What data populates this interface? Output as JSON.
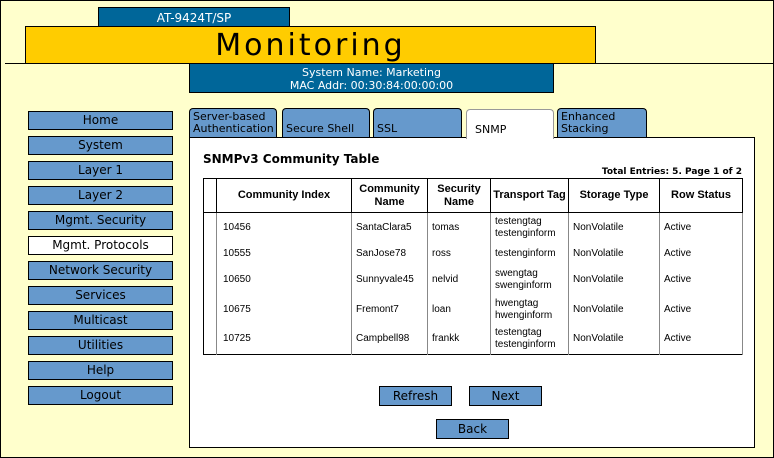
{
  "header": {
    "model": "AT-9424T/SP",
    "title": "Monitoring",
    "system_name": "System Name: Marketing",
    "mac_addr": "MAC Addr: 00:30:84:00:00:00"
  },
  "sidebar": {
    "items": [
      {
        "label": "Home"
      },
      {
        "label": "System"
      },
      {
        "label": "Layer 1"
      },
      {
        "label": "Layer 2"
      },
      {
        "label": "Mgmt. Security"
      },
      {
        "label": "Mgmt. Protocols",
        "selected": true
      },
      {
        "label": "Network Security"
      },
      {
        "label": "Services"
      },
      {
        "label": "Multicast"
      },
      {
        "label": "Utilities"
      },
      {
        "label": "Help"
      },
      {
        "label": "Logout"
      }
    ]
  },
  "tabs": [
    {
      "line1": "Server-based",
      "line2": "Authentication"
    },
    {
      "line1": "",
      "line2": "Secure Shell"
    },
    {
      "line1": "",
      "line2": "SSL"
    },
    {
      "line1": "",
      "line2": "SNMP",
      "selected": true
    },
    {
      "line1": "Enhanced",
      "line2": "Stacking"
    }
  ],
  "table": {
    "title": "SNMPv3 Community Table",
    "entries": "Total Entries: 5. Page 1 of 2",
    "headers": [
      "Community Index",
      "Community Name",
      "Security Name",
      "Transport Tag",
      "Storage Type",
      "Row Status"
    ],
    "rows": [
      [
        "10456",
        "SantaClara5",
        "tomas",
        "testengtag\ntestenginform",
        "NonVolatile",
        "Active"
      ],
      [
        "10555",
        "SanJose78",
        "ross",
        "testenginform",
        "NonVolatile",
        "Active"
      ],
      [
        "10650",
        "Sunnyvale45",
        "nelvid",
        "swengtag\nswenginform",
        "NonVolatile",
        "Active"
      ],
      [
        "10675",
        "Fremont7",
        "loan",
        "hwengtag\nhwenginform",
        "NonVolatile",
        "Active"
      ],
      [
        "10725",
        "Campbell98",
        "frankk",
        "testengtag\ntestenginform",
        "NonVolatile",
        "Active"
      ]
    ]
  },
  "buttons": {
    "refresh": "Refresh",
    "next": "Next",
    "back": "Back"
  }
}
